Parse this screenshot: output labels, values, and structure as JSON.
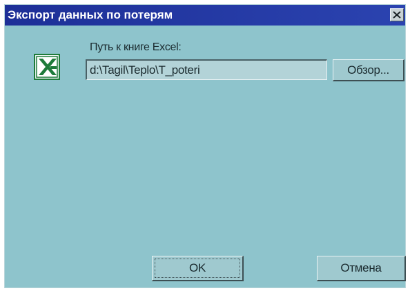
{
  "window": {
    "title": "Экспорт данных по потерям",
    "close_label": "×"
  },
  "form": {
    "path_label": "Путь к книге Excel:",
    "path_value": "d:\\Tagil\\Teplo\\T_poteri",
    "browse_label": "Обзор..."
  },
  "buttons": {
    "ok_label": "OK",
    "cancel_label": "Отмена"
  },
  "icons": {
    "app_icon": "excel-icon",
    "close_icon": "close-icon"
  },
  "colors": {
    "dialog_background": "#8ec4cc",
    "titlebar": "#1d2f97",
    "excel_green": "#1e7b3a"
  }
}
